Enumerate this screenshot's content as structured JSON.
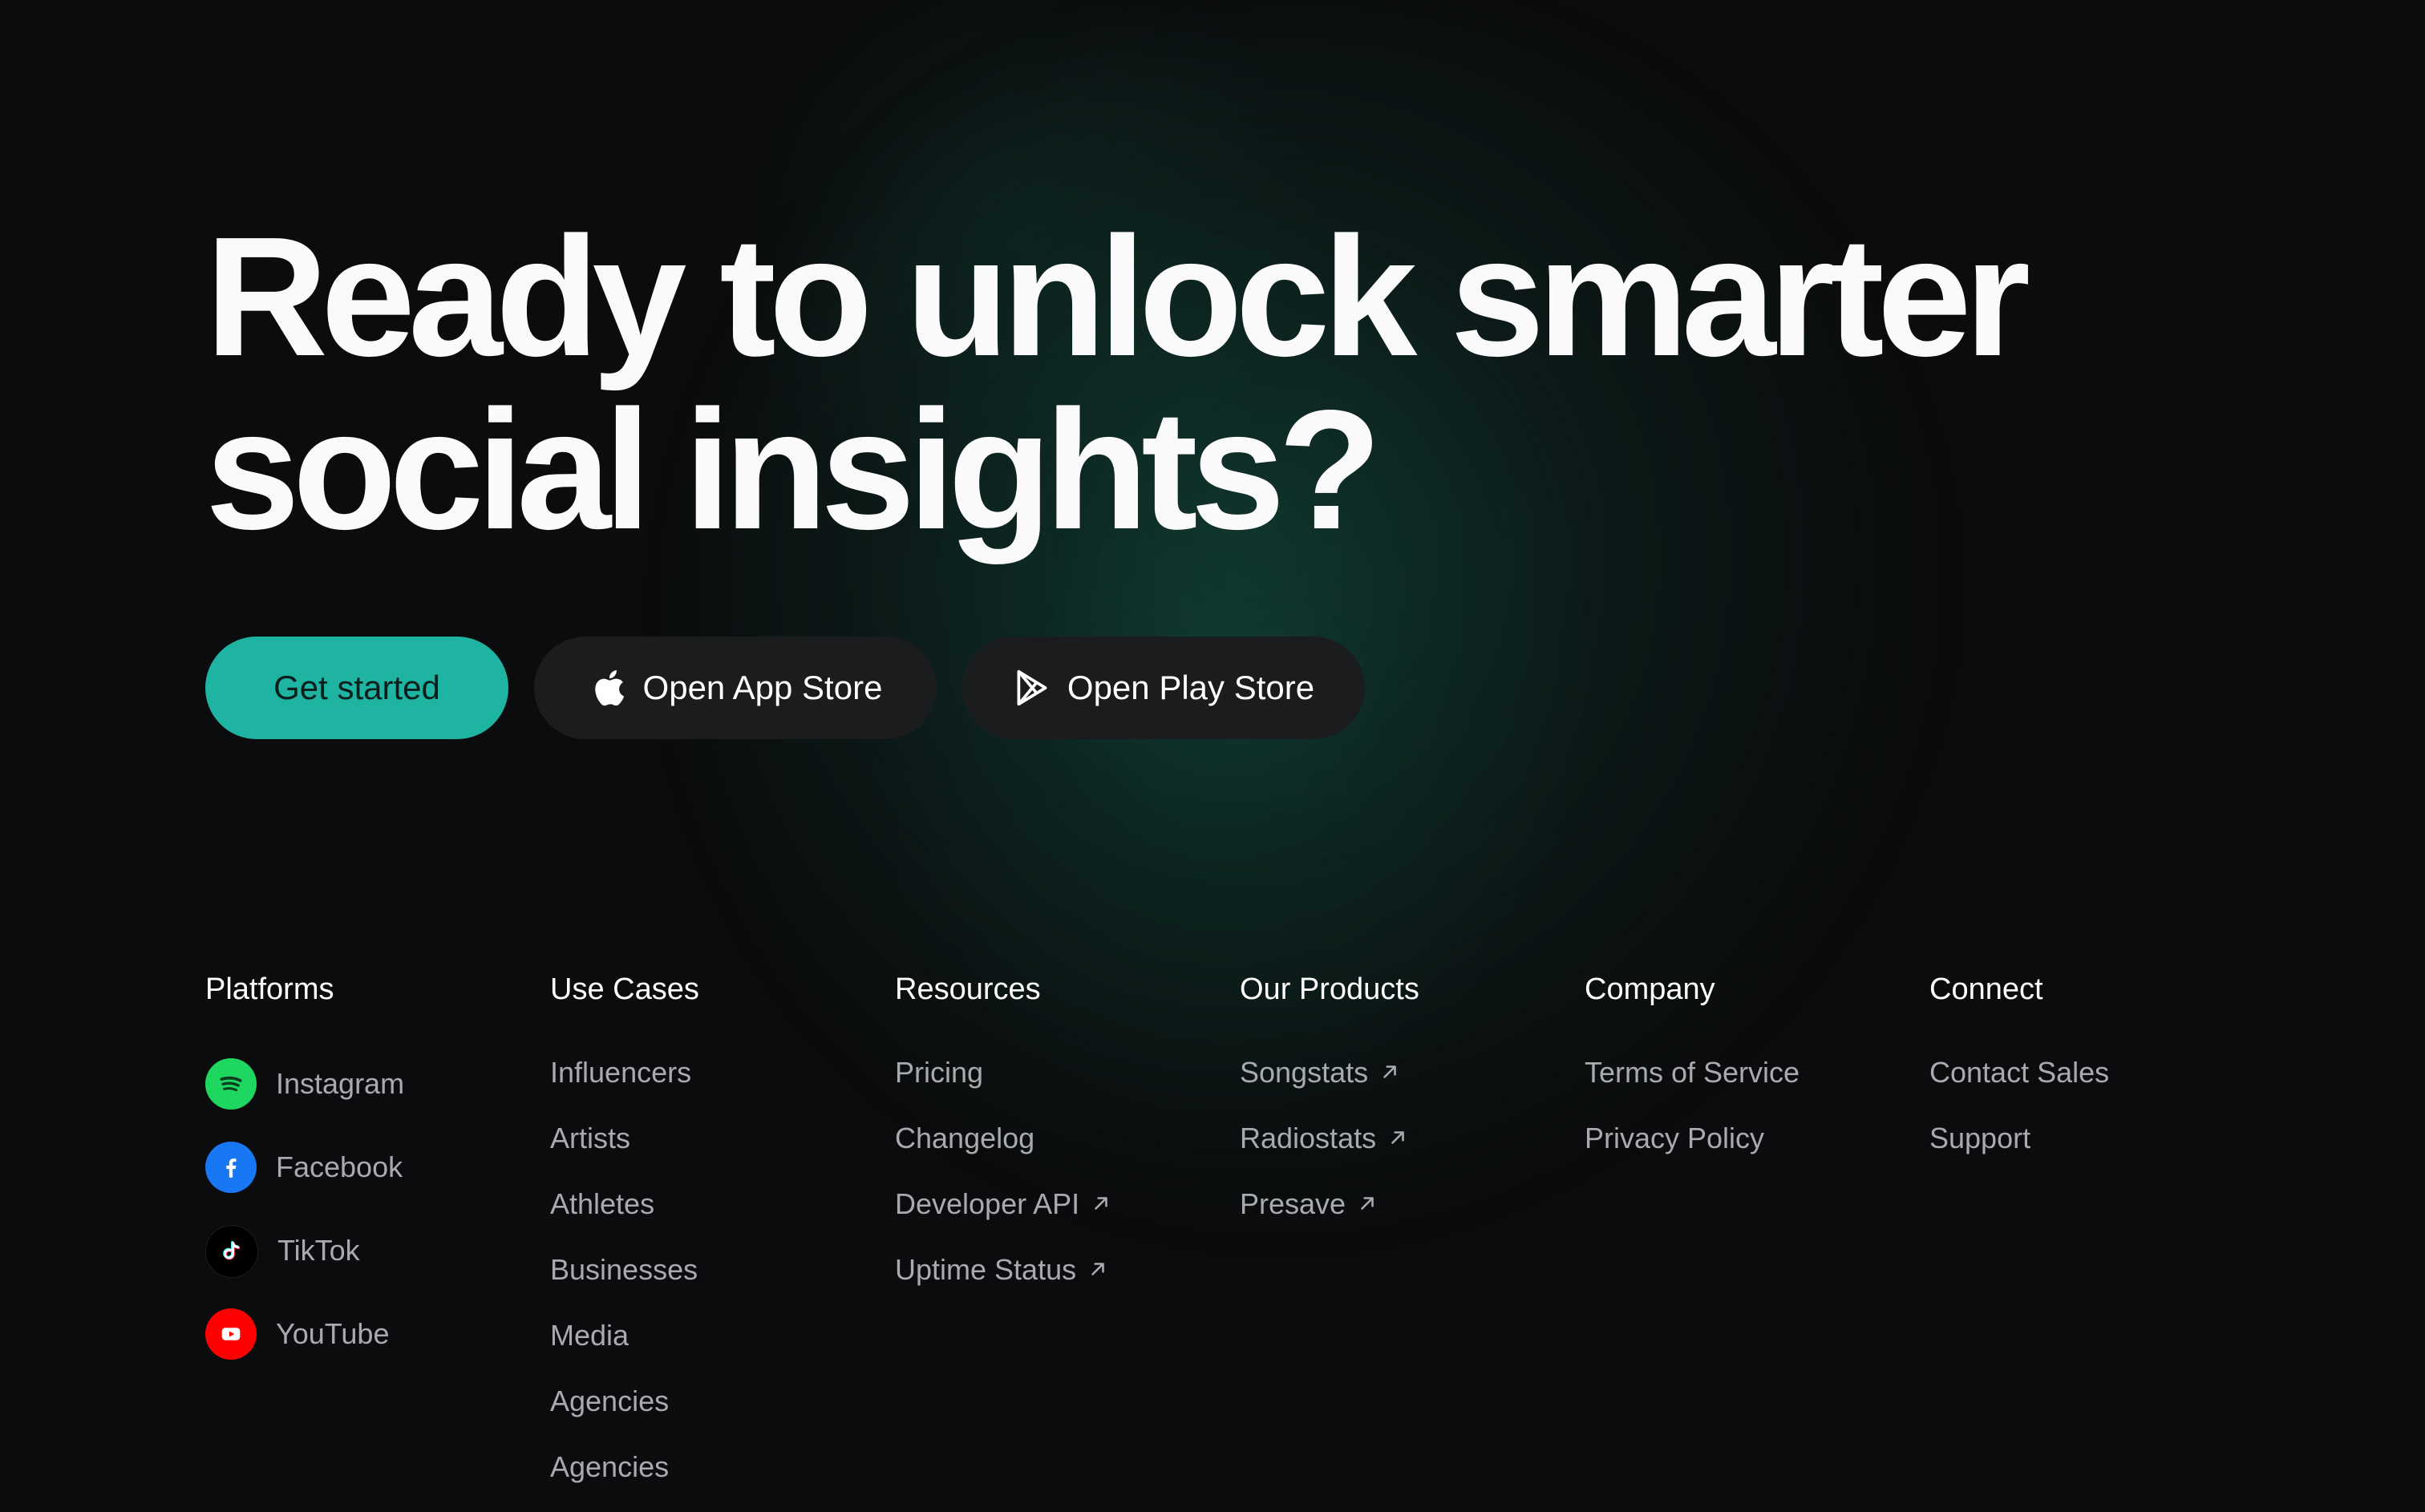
{
  "hero": {
    "title_line1": "Ready to unlock smarter",
    "title_line2": "social insights?"
  },
  "cta": {
    "get_started": "Get started",
    "app_store": "Open App Store",
    "play_store": "Open Play Store"
  },
  "colors": {
    "accent": "#1fb3a2",
    "background": "#0b0c0d",
    "button_dark": "#1b1c1e",
    "link_text": "#a9aaad"
  },
  "footer": {
    "platforms": {
      "title": "Platforms",
      "items": [
        {
          "label": "Instagram",
          "icon": "spotify-icon",
          "color": "#1ed760"
        },
        {
          "label": "Facebook",
          "icon": "facebook-icon",
          "color": "#1877f2"
        },
        {
          "label": "TikTok",
          "icon": "tiktok-icon",
          "color": "#000000"
        },
        {
          "label": "YouTube",
          "icon": "youtube-icon",
          "color": "#ff0000"
        }
      ]
    },
    "use_cases": {
      "title": "Use Cases",
      "items": [
        "Influencers",
        "Artists",
        "Athletes",
        "Businesses",
        "Media",
        "Agencies",
        "Agencies"
      ]
    },
    "resources": {
      "title": "Resources",
      "items": [
        {
          "label": "Pricing",
          "external": false
        },
        {
          "label": "Changelog",
          "external": false
        },
        {
          "label": "Developer API",
          "external": true
        },
        {
          "label": "Uptime Status",
          "external": true
        }
      ]
    },
    "our_products": {
      "title": "Our Products",
      "items": [
        {
          "label": "Songstats",
          "external": true
        },
        {
          "label": "Radiostats",
          "external": true
        },
        {
          "label": "Presave",
          "external": true
        }
      ]
    },
    "company": {
      "title": "Company",
      "items": [
        "Terms of Service",
        "Privacy Policy"
      ]
    },
    "connect": {
      "title": "Connect",
      "items": [
        "Contact Sales",
        "Support"
      ]
    }
  }
}
